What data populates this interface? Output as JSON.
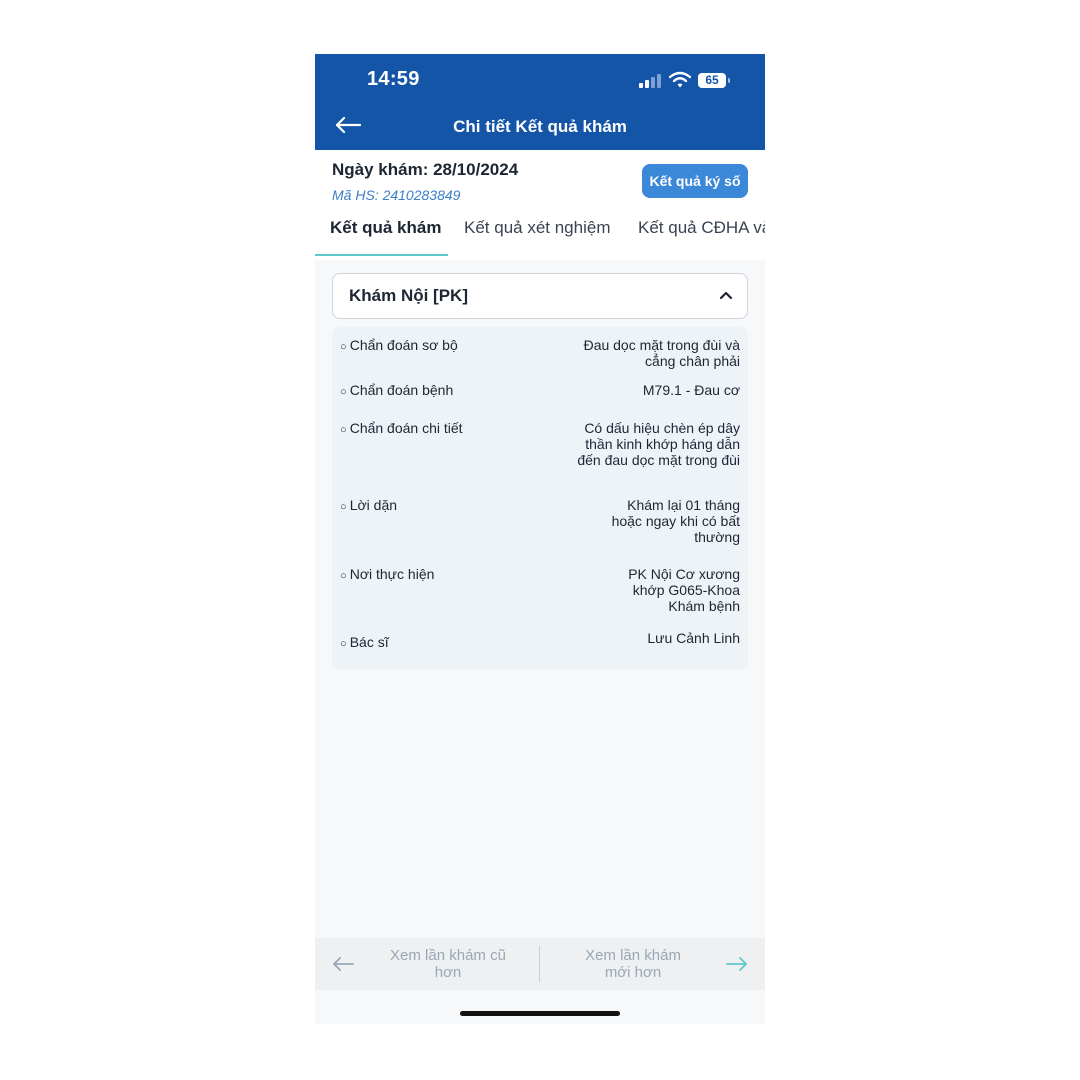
{
  "status_bar": {
    "time": "14:59",
    "battery": "65"
  },
  "nav": {
    "title": "Chi tiết Kết quả khám"
  },
  "visit": {
    "date_label": "Ngày khám: 28/10/2024",
    "record_id": "Mã HS: 2410283849",
    "signed_button": "Kết quả ký số"
  },
  "tabs": [
    {
      "label": "Kết quả khám",
      "active": true
    },
    {
      "label": "Kết quả xét nghiệm",
      "active": false
    },
    {
      "label": "Kết quả CĐHA và",
      "active": false
    }
  ],
  "section": {
    "title": "Khám Nội [PK]",
    "rows": [
      {
        "label": "Chẩn đoán sơ bộ",
        "value": "Đau dọc mặt trong đùi và cẳng chân phải"
      },
      {
        "label": "Chẩn đoán bệnh",
        "value": "M79.1 - Đau cơ"
      },
      {
        "label": "Chẩn đoán chi tiết",
        "value": "Có dấu hiệu chèn ép dây thần kinh khớp háng dẫn đến đau dọc mặt trong đùi"
      },
      {
        "label": "Lời dặn",
        "value": "Khám lại 01 tháng hoặc ngay khi có bất thường"
      },
      {
        "label": "Nơi thực hiện",
        "value": "PK Nội Cơ xương khớp G065-Khoa Khám bệnh"
      },
      {
        "label": "Bác sĩ",
        "value": "Lưu Cảnh Linh"
      }
    ]
  },
  "footer": {
    "older_label": "Xem lần khám cũ hơn",
    "newer_label": "Xem lần khám mới hơn"
  },
  "colors": {
    "header": "#1455a8",
    "accent": "#3b87d8",
    "tab_indicator": "#5fc7c9"
  }
}
